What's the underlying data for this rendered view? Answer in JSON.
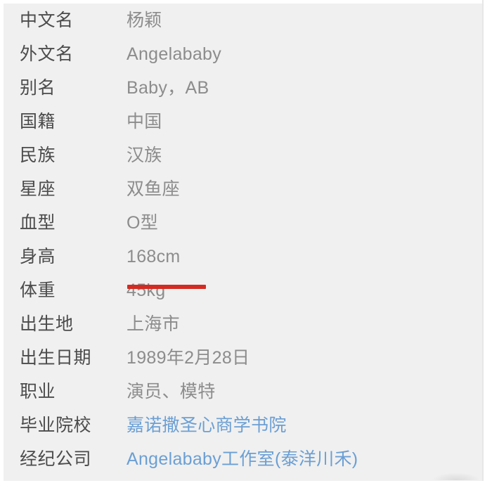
{
  "colors": {
    "page_background": "#ffffff",
    "panel_background": "#f0f0f0",
    "label_text": "#4b4b4b",
    "value_text": "#8c8c8c",
    "link_text": "#6b9fd4",
    "highlight": "#d32b22",
    "divider": "#e7e7e7"
  },
  "infobox": {
    "rows": [
      {
        "label": "中文名",
        "value": "杨颖",
        "is_link": false
      },
      {
        "label": "外文名",
        "value": "Angelababy",
        "is_link": false
      },
      {
        "label": "别名",
        "value": "Baby，AB",
        "is_link": false
      },
      {
        "label": "国籍",
        "value": "中国",
        "is_link": false
      },
      {
        "label": "民族",
        "value": "汉族",
        "is_link": false
      },
      {
        "label": "星座",
        "value": "双鱼座",
        "is_link": false
      },
      {
        "label": "血型",
        "value": "O型",
        "is_link": false
      },
      {
        "label": "身高",
        "value": "168cm",
        "is_link": false
      },
      {
        "label": "体重",
        "value": "45kg",
        "is_link": false
      },
      {
        "label": "出生地",
        "value": "上海市",
        "is_link": false
      },
      {
        "label": "出生日期",
        "value": "1989年2月28日",
        "is_link": false
      },
      {
        "label": "职业",
        "value": "演员、模特",
        "is_link": false
      },
      {
        "label": "毕业院校",
        "value": "嘉诺撒圣心商学书院",
        "is_link": true
      },
      {
        "label": "经纪公司",
        "value": "Angelababy工作室(泰洋川禾)",
        "is_link": true
      }
    ]
  },
  "annotation": {
    "highlight_target_label": "身高",
    "highlight_target_value": "168cm"
  }
}
